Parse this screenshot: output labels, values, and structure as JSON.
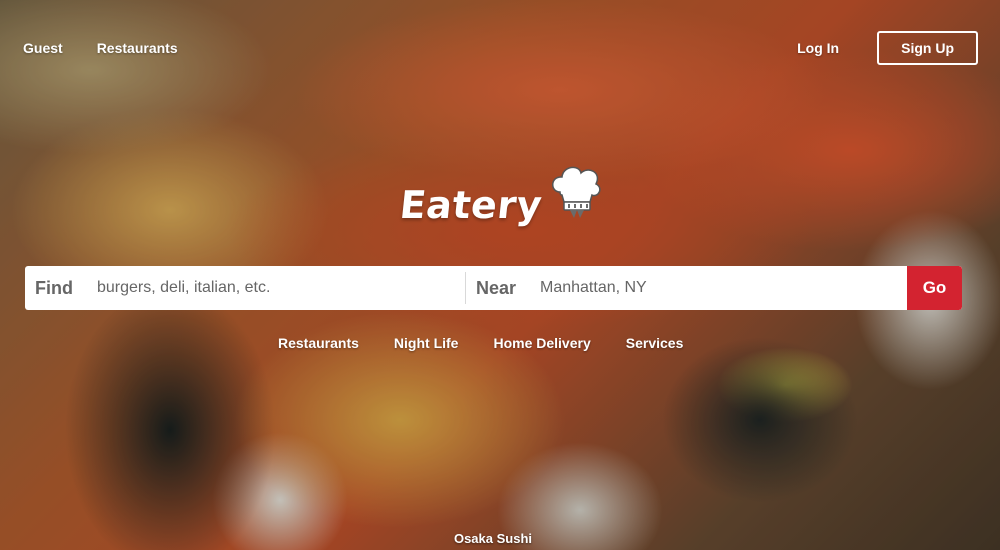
{
  "nav": {
    "left": [
      "Guest",
      "Restaurants"
    ],
    "login_label": "Log In",
    "signup_label": "Sign Up"
  },
  "brand": {
    "name": "Eatery",
    "icon": "chef-hat-icon"
  },
  "search": {
    "find_label": "Find",
    "find_placeholder": "burgers, deli, italian, etc.",
    "near_label": "Near",
    "near_placeholder": "Manhattan, NY",
    "go_label": "Go"
  },
  "categories": [
    "Restaurants",
    "Night Life",
    "Home Delivery",
    "Services"
  ],
  "photo_caption": "Osaka Sushi",
  "colors": {
    "accent": "#d32330",
    "text": "#ffffff",
    "search_text": "#666666"
  }
}
